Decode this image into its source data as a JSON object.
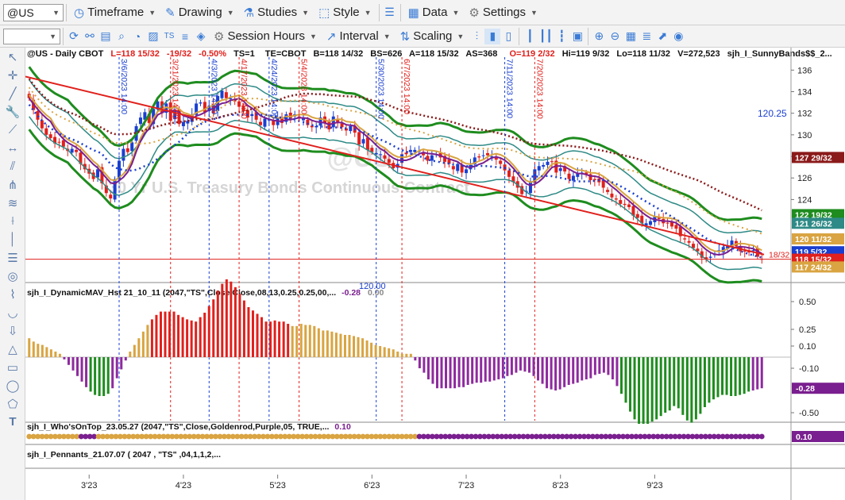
{
  "toolbar": {
    "symbol": "@US",
    "timeframe": "Timeframe",
    "drawing": "Drawing",
    "studies": "Studies",
    "style": "Style",
    "data": "Data",
    "settings": "Settings",
    "session_hours": "Session Hours",
    "interval": "Interval",
    "scaling": "Scaling"
  },
  "colors": {
    "up_bar": "#1a3fd0",
    "down_bar": "#e0201c",
    "green_band": "#1e8c1e",
    "teal_band": "#2e8a86",
    "purple_ma": "#7a1f8f",
    "gold_ma": "#d9a441",
    "blue_dots": "#1a3fd0",
    "maroon_dots": "#8b1a1a",
    "trend_red": "#e0201c"
  },
  "main_pane": {
    "header": {
      "symbol": "@US - Daily CBOT",
      "L": "L=118 15/32",
      "chg": "-19/32",
      "pct": "-0.50%",
      "ts": "TS=1",
      "te": "TE=CBOT",
      "b": "B=118 14/32",
      "bs": "BS=626",
      "a": "A=118 15/32",
      "as": "AS=368",
      "o": "O=119 2/32",
      "hi": "Hi=119 9/32",
      "lo": "Lo=118 11/32",
      "v": "V=272,523",
      "study": "sjh_I_SunnyBands$$_2..."
    },
    "watermark_symbol": "@US",
    "watermark_name": "30 Yr U.S. Treasury Bonds Continuous Contract",
    "annotation_value": "120.25",
    "partial_label": "120.00",
    "event_lines": [
      {
        "label": "3/6/2023 14:00",
        "color": "#1a3fd0"
      },
      {
        "label": "3/21/2023 14:00",
        "color": "#e0201c"
      },
      {
        "label": "4/3/2023 14:00",
        "color": "#1a3fd0"
      },
      {
        "label": "4/17/2023 14:00",
        "color": "#e0201c"
      },
      {
        "label": "4/24/2023 14:00",
        "color": "#1a3fd0"
      },
      {
        "label": "5/4/2023 14:00",
        "color": "#e0201c"
      },
      {
        "label": "5/30/2023 14:00",
        "color": "#1a3fd0"
      },
      {
        "label": "6/7/2023 14:00",
        "color": "#e0201c"
      },
      {
        "label": "7/11/2023 14:00",
        "color": "#1a3fd0"
      },
      {
        "label": "7/20/2023 14:00",
        "color": "#e0201c"
      }
    ],
    "price_badges": [
      {
        "text": "127 29/32",
        "bg": "#8b1a1a",
        "price": 127.9
      },
      {
        "text": "122 19/32",
        "bg": "#1e8c1e",
        "price": 122.6
      },
      {
        "text": "121 26/32",
        "bg": "#2e8a86",
        "price": 121.8
      },
      {
        "text": "120 11/32",
        "bg": "#d9a441",
        "price": 120.35
      },
      {
        "text": "119 5/32",
        "bg": "#1a3fd0",
        "price": 119.16
      },
      {
        "text": "118 15/32",
        "bg": "#e0201c",
        "price": 118.47
      },
      {
        "text": "117 24/32",
        "bg": "#d9a441",
        "price": 117.75
      }
    ],
    "red_level_label": "18/32"
  },
  "chart_data": [
    {
      "type": "candlestick",
      "title": "@US - Daily CBOT",
      "ylim": [
        116.6,
        137.2
      ],
      "yticks": [
        124,
        126,
        128,
        130,
        132,
        134,
        136
      ],
      "x_labels": [
        "3'23",
        "4'23",
        "5'23",
        "6'23",
        "7'23",
        "8'23",
        "9'23"
      ],
      "close": [
        133.4,
        132.3,
        131.4,
        130.6,
        130.0,
        129.7,
        129.2,
        129.3,
        128.9,
        128.5,
        128.7,
        128.4,
        127.3,
        126.8,
        126.4,
        125.9,
        126.8,
        125.5,
        124.6,
        124.1,
        125.9,
        127.6,
        128.7,
        128.4,
        129.3,
        130.8,
        131.6,
        132.1,
        131.1,
        132.4,
        133.1,
        132.0,
        132.9,
        131.3,
        132.2,
        131.0,
        131.2,
        131.3,
        131.9,
        132.9,
        133.0,
        132.1,
        132.7,
        132.0,
        133.6,
        134.1,
        133.4,
        133.4,
        133.1,
        132.6,
        132.2,
        131.6,
        131.9,
        131.4,
        130.9,
        131.5,
        131.4,
        130.9,
        131.6,
        131.1,
        131.9,
        131.5,
        131.9,
        131.5,
        131.5,
        130.9,
        130.7,
        130.8,
        131.6,
        131.1,
        130.5,
        131.7,
        131.2,
        130.7,
        130.4,
        130.8,
        130.2,
        129.1,
        129.6,
        128.6,
        128.4,
        128.3,
        128.2,
        127.8,
        127.4,
        126.9,
        127.3,
        128.2,
        128.2,
        128.6,
        128.6,
        128.5,
        128.1,
        127.6,
        128.1,
        128.2,
        127.9,
        127.5,
        127.3,
        126.8,
        127.3,
        126.5,
        126.8,
        127.2,
        127.9,
        127.9,
        128.1,
        128.1,
        128.0,
        127.7,
        127.3,
        126.7,
        126.1,
        125.6,
        125.1,
        124.5,
        124.8,
        125.7,
        126.8,
        127.1,
        127.2,
        127.5,
        127.5,
        126.5,
        126.9,
        126.6,
        125.9,
        126.2,
        126.4,
        126.5,
        126.3,
        125.8,
        125.8,
        125.6,
        125.1,
        124.7,
        124.2,
        124.0,
        123.6,
        123.5,
        123.3,
        122.5,
        122.3,
        121.8,
        121.8,
        122.0,
        122.4,
        122.2,
        121.8,
        121.8,
        121.5,
        121.3,
        120.6,
        120.3,
        120.0,
        119.5,
        119.2,
        118.6,
        118.5,
        118.7,
        119.0,
        119.3,
        119.6,
        119.7,
        120.2,
        119.7,
        119.2,
        119.2,
        119.1,
        119.3,
        118.7,
        118.47
      ],
      "ohlc_note": "daily OHLC bars with Sunny Bands overlay"
    },
    {
      "type": "bar",
      "title": "sjh_I_DynamicMAV_Hst 21_10_11 (2047,\"TS\",Close,Close,08,13,0.25,0.25,00,...",
      "readout_1": "-0.28",
      "readout_2": "0.00",
      "yticks": [
        -0.5,
        -0.1,
        0.1,
        0.25,
        0.5
      ],
      "ytick_labels": [
        "-0.50",
        "-0.10",
        "0.10",
        "0.25",
        "0.50"
      ],
      "last_value_badge": "-0.28",
      "values": [
        0.17,
        0.14,
        0.12,
        0.11,
        0.09,
        0.07,
        0.05,
        0.03,
        -0.02,
        -0.07,
        -0.12,
        -0.17,
        -0.22,
        -0.27,
        -0.31,
        -0.34,
        -0.35,
        -0.35,
        -0.33,
        -0.28,
        -0.19,
        -0.11,
        -0.03,
        0.05,
        0.11,
        0.17,
        0.23,
        0.29,
        0.34,
        0.38,
        0.41,
        0.41,
        0.41,
        0.41,
        0.38,
        0.36,
        0.34,
        0.33,
        0.32,
        0.36,
        0.4,
        0.46,
        0.52,
        0.6,
        0.66,
        0.7,
        0.68,
        0.63,
        0.57,
        0.51,
        0.45,
        0.42,
        0.39,
        0.36,
        0.32,
        0.32,
        0.33,
        0.32,
        0.32,
        0.3,
        0.28,
        0.28,
        0.3,
        0.29,
        0.29,
        0.28,
        0.26,
        0.24,
        0.24,
        0.23,
        0.22,
        0.21,
        0.2,
        0.2,
        0.19,
        0.18,
        0.17,
        0.15,
        0.13,
        0.11,
        0.1,
        0.09,
        0.08,
        0.07,
        0.05,
        0.03,
        0.03,
        0.03,
        -0.03,
        -0.1,
        -0.14,
        -0.2,
        -0.24,
        -0.28,
        -0.28,
        -0.28,
        -0.28,
        -0.28,
        -0.27,
        -0.27,
        -0.25,
        -0.24,
        -0.23,
        -0.23,
        -0.22,
        -0.22,
        -0.21,
        -0.2,
        -0.19,
        -0.17,
        -0.16,
        -0.14,
        -0.12,
        -0.13,
        -0.14,
        -0.17,
        -0.21,
        -0.24,
        -0.28,
        -0.29,
        -0.3,
        -0.29,
        -0.27,
        -0.25,
        -0.24,
        -0.23,
        -0.21,
        -0.2,
        -0.19,
        -0.16,
        -0.15,
        -0.14,
        -0.16,
        -0.2,
        -0.26,
        -0.33,
        -0.41,
        -0.49,
        -0.56,
        -0.6,
        -0.6,
        -0.6,
        -0.58,
        -0.56,
        -0.53,
        -0.5,
        -0.48,
        -0.44,
        -0.46,
        -0.52,
        -0.57,
        -0.59,
        -0.56,
        -0.51,
        -0.45,
        -0.41,
        -0.38,
        -0.36,
        -0.34,
        -0.34,
        -0.35,
        -0.35,
        -0.34,
        -0.33,
        -0.31,
        -0.3,
        -0.29,
        -0.28
      ]
    },
    {
      "type": "scatter",
      "title": "sjh_I_Who'sOnTop_23.05.27 (2047,\"TS\",Close,Goldenrod,Purple,05, TRUE,...",
      "readout": "0.10",
      "last_value_badge": "0.10",
      "sequence": [
        "G",
        "G",
        "G",
        "G",
        "G",
        "G",
        "G",
        "G",
        "G",
        "G",
        "G",
        "G",
        "P",
        "P",
        "P",
        "P",
        "G",
        "G",
        "G",
        "G",
        "G",
        "G",
        "G",
        "G",
        "G",
        "G",
        "G",
        "G",
        "G",
        "G",
        "G",
        "G",
        "G",
        "G",
        "G",
        "G",
        "G",
        "G",
        "G",
        "G",
        "G",
        "G",
        "G",
        "G",
        "G",
        "G",
        "G",
        "G",
        "G",
        "G",
        "G",
        "G",
        "G",
        "G",
        "G",
        "G",
        "G",
        "G",
        "G",
        "G",
        "G",
        "G",
        "G",
        "G",
        "G",
        "G",
        "G",
        "G",
        "G",
        "G",
        "G",
        "G",
        "G",
        "G",
        "G",
        "G",
        "G",
        "G",
        "G",
        "G",
        "G",
        "G",
        "G",
        "G",
        "G",
        "G",
        "G",
        "G",
        "G",
        "G",
        "P",
        "P",
        "P",
        "P",
        "P",
        "P",
        "P",
        "P",
        "P",
        "P",
        "P",
        "P",
        "P",
        "P",
        "P",
        "P",
        "P",
        "P",
        "P",
        "P",
        "P",
        "P",
        "P",
        "P",
        "P",
        "P",
        "P",
        "P",
        "P",
        "P",
        "P",
        "P",
        "P",
        "P",
        "P",
        "P",
        "P",
        "P",
        "P",
        "P",
        "P",
        "P",
        "P",
        "P",
        "P",
        "P",
        "P",
        "P",
        "P",
        "P",
        "P",
        "P",
        "P",
        "P",
        "P",
        "P",
        "P",
        "P",
        "P",
        "P",
        "P",
        "P",
        "P",
        "P",
        "P",
        "P",
        "P",
        "P",
        "P",
        "P",
        "P",
        "P",
        "P",
        "P",
        "P",
        "P",
        "P",
        "P",
        "P",
        "P"
      ]
    },
    {
      "type": "table",
      "title": "sjh_I_Pennants_21.07.07 (  2047 ,  \"TS\" ,04,1,1,2,..."
    }
  ]
}
